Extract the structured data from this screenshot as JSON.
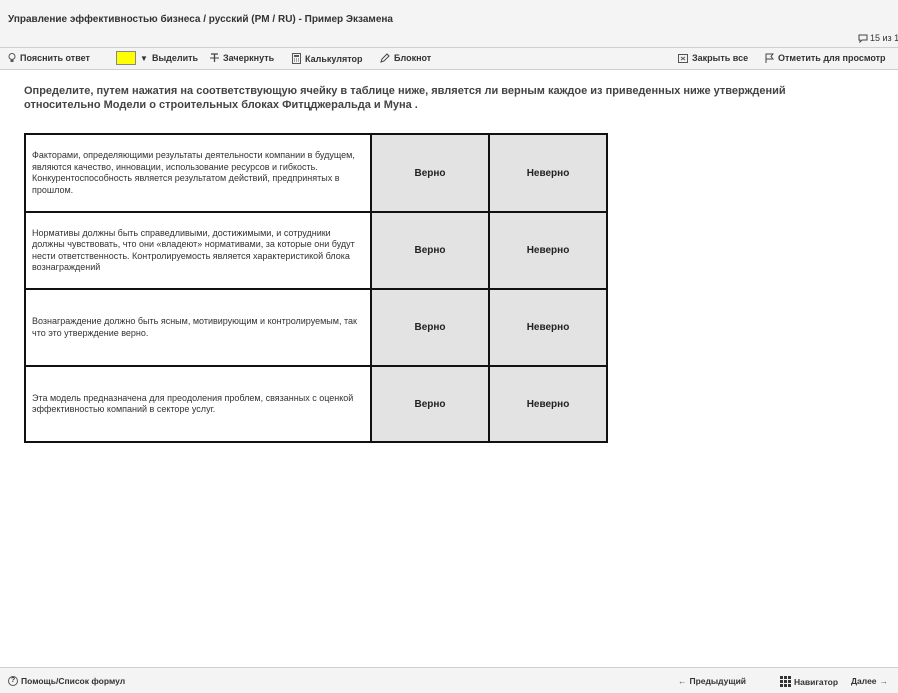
{
  "window": {
    "title": "Управление эффективностью бизнеса / русский (PM / RU) - Пример Экзамена",
    "question_counter": "15 из 1"
  },
  "toolbar": {
    "explain_label": "Пояснить ответ",
    "highlight_label": "Выделить",
    "highlight_color": "#ffff00",
    "strike_label": "Зачеркнуть",
    "calculator_label": "Калькулятор",
    "notepad_label": "Блокнот",
    "close_all_label": "Закрыть все",
    "flag_label": "Отметить для просмотр"
  },
  "question": {
    "text": "Определите, путем нажатия на соответствующую ячейку в таблице ниже, является ли верным каждое из приведенных ниже утверждений относительно Модели о строительных блоках Фитцджеральда и Муна ."
  },
  "table": {
    "rows": [
      {
        "statement": "Факторами, определяющими результаты деятельности компании в будущем, являются качество, инновации, использование ресурсов и гибкость. Конкурентоспособность является результатом действий, предпринятых в прошлом.",
        "true_label": "Верно",
        "false_label": "Неверно"
      },
      {
        "statement": "Нормативы должны быть справедливыми, достижимыми, и сотрудники должны чувствовать, что они «владеют» нормативами, за которые они будут нести ответственность. Контролируемость является характеристикой блока вознаграждений",
        "true_label": "Верно",
        "false_label": "Неверно"
      },
      {
        "statement": "Вознаграждение должно быть ясным, мотивирующим и контролируемым, так что это утверждение верно.",
        "true_label": "Верно",
        "false_label": "Неверно"
      },
      {
        "statement": "Эта модель предназначена для преодоления проблем, связанных с оценкой эффективностью компаний в секторе услуг.",
        "true_label": "Верно",
        "false_label": "Неверно"
      }
    ]
  },
  "statusbar": {
    "help_label": "Помощь/Список формул",
    "prev_label": "Предыдущий",
    "navigator_label": "Навигатор",
    "next_label": "Далее"
  }
}
